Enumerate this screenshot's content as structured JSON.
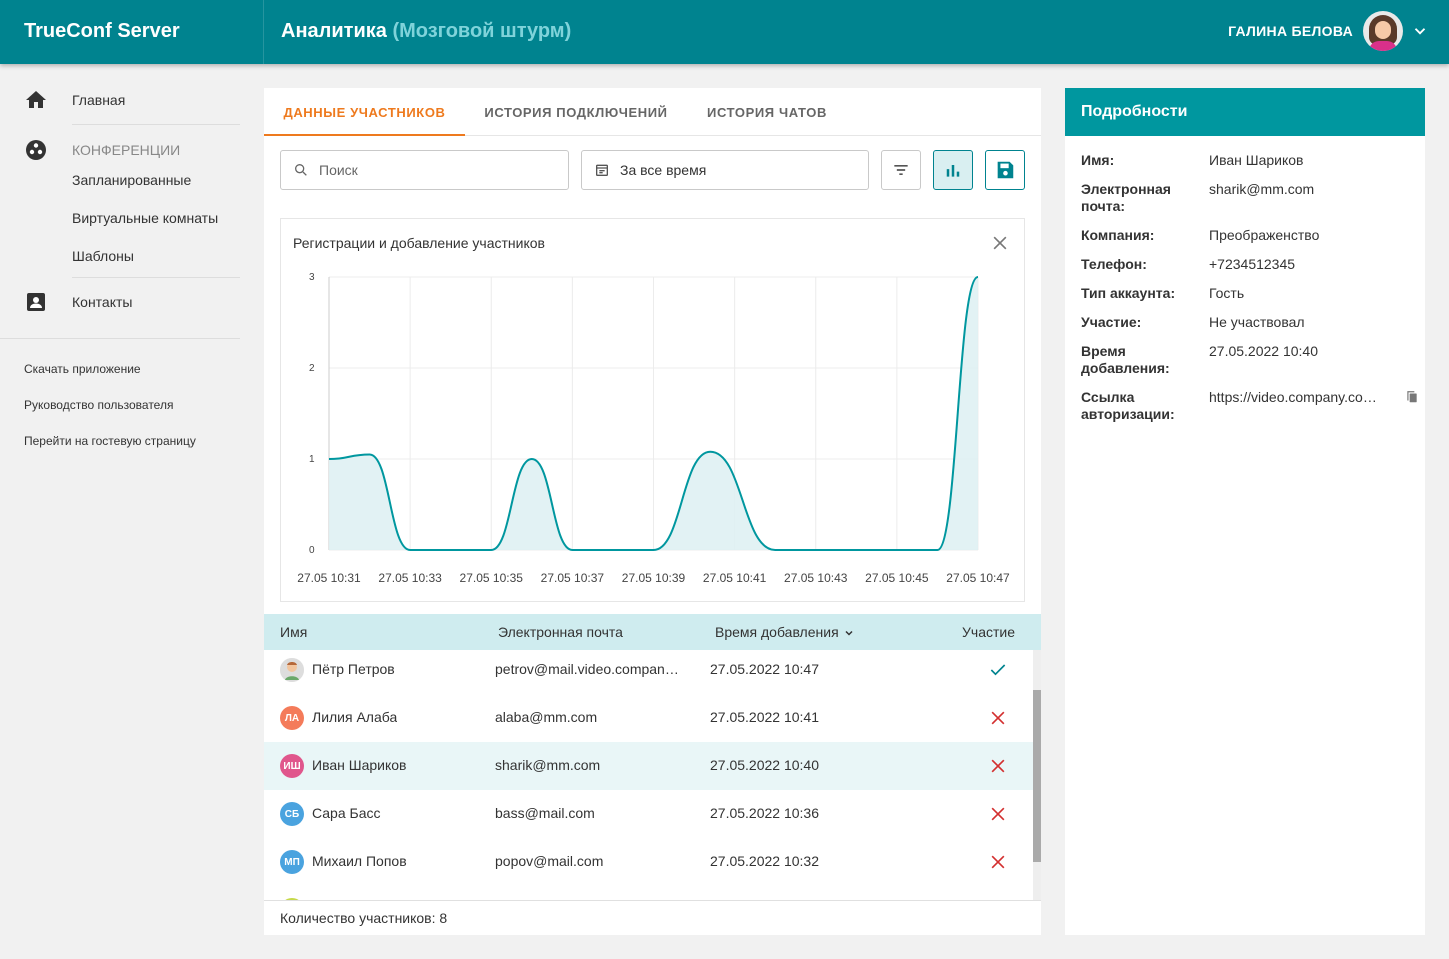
{
  "header": {
    "brand": "TrueConf Server",
    "title": "Аналитика",
    "subtitle": "(Мозговой штурм)",
    "user_name": "ГАЛИНА БЕЛОВА"
  },
  "sidebar": {
    "home": "Главная",
    "conferences": "КОНФЕРЕНЦИИ",
    "scheduled": "Запланированные",
    "virtual_rooms": "Виртуальные комнаты",
    "templates": "Шаблоны",
    "contacts": "Контакты",
    "links": [
      "Скачать приложение",
      "Руководство пользователя",
      "Перейти на гостевую страницу"
    ]
  },
  "tabs": [
    "ДАННЫЕ УЧАСТНИКОВ",
    "ИСТОРИЯ ПОДКЛЮЧЕНИЙ",
    "ИСТОРИЯ ЧАТОВ"
  ],
  "toolbar": {
    "search_placeholder": "Поиск",
    "period": "За все время"
  },
  "colors": {
    "primary": "#00838f",
    "accent": "#ee7a1e",
    "success": "#00838f",
    "error": "#d32f2f"
  },
  "chart_data": {
    "type": "area",
    "title": "Регистрации и добавление участников",
    "x": [
      "27.05 10:31",
      "27.05 10:33",
      "27.05 10:35",
      "27.05 10:37",
      "27.05 10:39",
      "27.05 10:41",
      "27.05 10:43",
      "27.05 10:45",
      "27.05 10:47"
    ],
    "y_ticks": [
      0,
      1,
      2,
      3
    ],
    "ylim": [
      0,
      3
    ],
    "points": [
      {
        "x": 0,
        "y": 1
      },
      {
        "x": 0.5,
        "y": 1.05
      },
      {
        "x": 1,
        "y": 0
      },
      {
        "x": 2,
        "y": 0
      },
      {
        "x": 2.5,
        "y": 1
      },
      {
        "x": 3,
        "y": 0
      },
      {
        "x": 4,
        "y": 0
      },
      {
        "x": 4.7,
        "y": 1.08
      },
      {
        "x": 5.5,
        "y": 0
      },
      {
        "x": 6,
        "y": 0
      },
      {
        "x": 7,
        "y": 0
      },
      {
        "x": 7.5,
        "y": 0
      },
      {
        "x": 8,
        "y": 3
      }
    ],
    "grid": true,
    "legend": "none"
  },
  "table": {
    "headers": {
      "name": "Имя",
      "email": "Электронная почта",
      "added": "Время добавления",
      "participation": "Участие"
    },
    "rows": [
      {
        "initials": "",
        "name": "Пётр Петров",
        "email": "petrov@mail.video.company.com",
        "added": "27.05.2022 10:47",
        "participated": true,
        "avatar_color": "#bdbdbd"
      },
      {
        "initials": "ЛА",
        "name": "Лилия Алаба",
        "email": "alaba@mm.com",
        "added": "27.05.2022 10:41",
        "participated": false,
        "avatar_color": "#f47b5a"
      },
      {
        "initials": "ИШ",
        "name": "Иван Шариков",
        "email": "sharik@mm.com",
        "added": "27.05.2022 10:40",
        "participated": false,
        "avatar_color": "#e0568c"
      },
      {
        "initials": "СБ",
        "name": "Сара Басс",
        "email": "bass@mail.com",
        "added": "27.05.2022 10:36",
        "participated": false,
        "avatar_color": "#4aa3df"
      },
      {
        "initials": "МП",
        "name": "Михаил Попов",
        "email": "popov@mail.com",
        "added": "27.05.2022 10:32",
        "participated": false,
        "avatar_color": "#4aa3df"
      }
    ],
    "count_label": "Количество участников: 8"
  },
  "details": {
    "title": "Подробности",
    "fields": [
      {
        "label": "Имя:",
        "value": "Иван Шариков"
      },
      {
        "label": "Электронная почта:",
        "value": "sharik@mm.com"
      },
      {
        "label": "Компания:",
        "value": "Преображенство"
      },
      {
        "label": "Телефон:",
        "value": "+7234512345"
      },
      {
        "label": "Тип аккаунта:",
        "value": "Гость"
      },
      {
        "label": "Участие:",
        "value": "Не участвовал"
      },
      {
        "label": "Время добавления:",
        "value": "27.05.2022 10:40"
      },
      {
        "label": "Ссылка авторизации:",
        "value": "https://video.company.com/guest/auth"
      }
    ]
  }
}
